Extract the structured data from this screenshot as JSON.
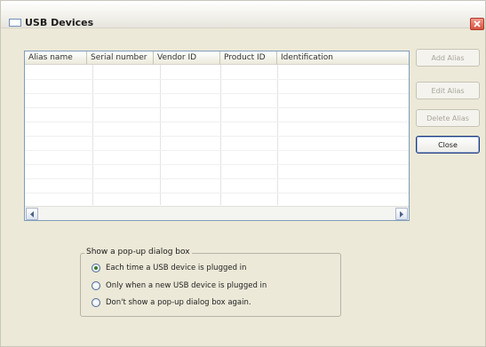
{
  "window": {
    "title": "USB Devices"
  },
  "listview": {
    "columns": [
      "Alias name",
      "Serial number",
      "Vendor ID",
      "Product ID",
      "Identification"
    ],
    "rows": []
  },
  "buttons": {
    "add_alias": "Add Alias",
    "edit_alias": "Edit Alias",
    "delete_alias": "Delete Alias",
    "close": "Close"
  },
  "popup_group": {
    "legend": "Show a pop-up dialog box",
    "options": [
      {
        "label": "Each time a USB device is plugged in",
        "checked": true
      },
      {
        "label": "Only when a new USB device is plugged in",
        "checked": false
      },
      {
        "label": "Don't show a pop-up dialog box again.",
        "checked": false
      }
    ]
  },
  "colors": {
    "window_bg": "#ece9d8",
    "listview_border": "#7f9db9",
    "default_button_border": "#1f3a7a",
    "close_button": "#d5543f"
  },
  "icons": {
    "app": "window-icon",
    "close": "close-x-icon",
    "scroll_left": "scroll-left-arrow-icon",
    "scroll_right": "scroll-right-arrow-icon"
  }
}
